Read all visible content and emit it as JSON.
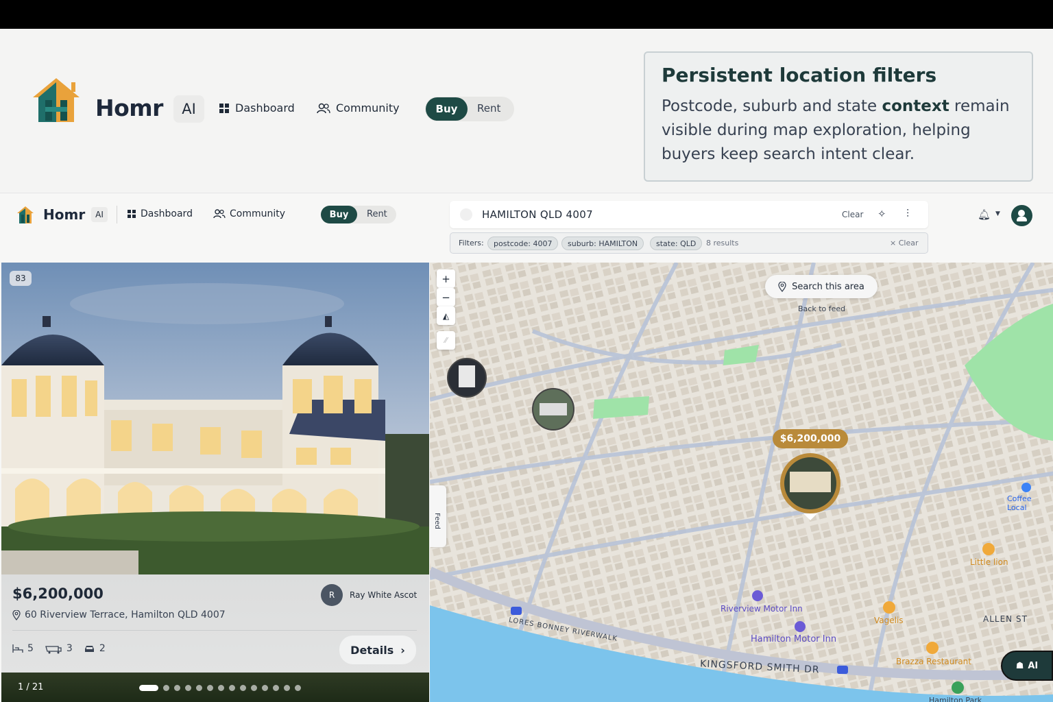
{
  "hero": {
    "brand": "Homr",
    "ai": "AI",
    "nav": [
      "Dashboard",
      "Community"
    ],
    "toggle": {
      "active": "Buy",
      "inactive": "Rent"
    }
  },
  "callout": {
    "title": "Persistent location filters",
    "text_before": "Postcode, suburb and state ",
    "text_bold": "context",
    "text_after": " remain visible during map exploration, helping buyers keep search intent clear."
  },
  "app": {
    "brand": "Homr",
    "ai": "AI",
    "nav": [
      "Dashboard",
      "Community"
    ],
    "toggle": {
      "active": "Buy",
      "inactive": "Rent"
    },
    "search": {
      "value": "HAMILTON QLD 4007",
      "clear": "Clear"
    },
    "filters": {
      "label": "Filters:",
      "chips": [
        "postcode: 4007",
        "suburb: HAMILTON",
        "state: QLD"
      ],
      "results": "8 results",
      "clear": "× Clear"
    }
  },
  "listing": {
    "photo_count": "83",
    "price": "$6,200,000",
    "address": "60 Riverview Terrace, Hamilton QLD 4007",
    "agent_initial": "R",
    "agent": "Ray White Ascot",
    "beds": "5",
    "baths": "3",
    "cars": "2",
    "details": "Details",
    "pager": "1 / 21",
    "dot_count": 14
  },
  "map": {
    "search_area": "Search this area",
    "back_to_feed": "Back to feed",
    "feed_tab": "Feed",
    "price_pin": "$6,200,000",
    "pois": [
      "Riverview Motor Inn",
      "Hamilton Motor Inn",
      "Vagelis",
      "Little lion",
      "Brazza Restaurant",
      "Hamilton Park",
      "Coffee Local"
    ],
    "streets": [
      "LORES BONNEY RIVERWALK",
      "KINGSFORD SMITH DR",
      "ALLEN ST"
    ],
    "ai_button": "AI"
  },
  "colors": {
    "accent": "#1e4a45",
    "price_pin": "#b98a3a",
    "water": "#7cc4ec",
    "park": "#9fe3a8"
  }
}
